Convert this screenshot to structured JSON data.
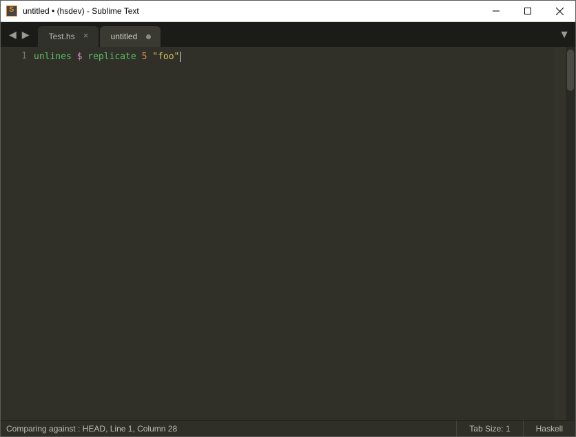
{
  "window": {
    "title": "untitled • (hsdev) - Sublime Text"
  },
  "tabs": [
    {
      "label": "Test.hs",
      "active": false,
      "dirty": false
    },
    {
      "label": "untitled",
      "active": true,
      "dirty": true
    }
  ],
  "editor": {
    "line_number": "1",
    "tokens": {
      "fn1": "unlines",
      "op": "$",
      "fn2": "replicate",
      "num": "5",
      "str": "\"foo\""
    }
  },
  "statusbar": {
    "left": "Comparing against : HEAD, Line 1, Column 28",
    "tab_size": "Tab Size: 1",
    "syntax": "Haskell"
  }
}
